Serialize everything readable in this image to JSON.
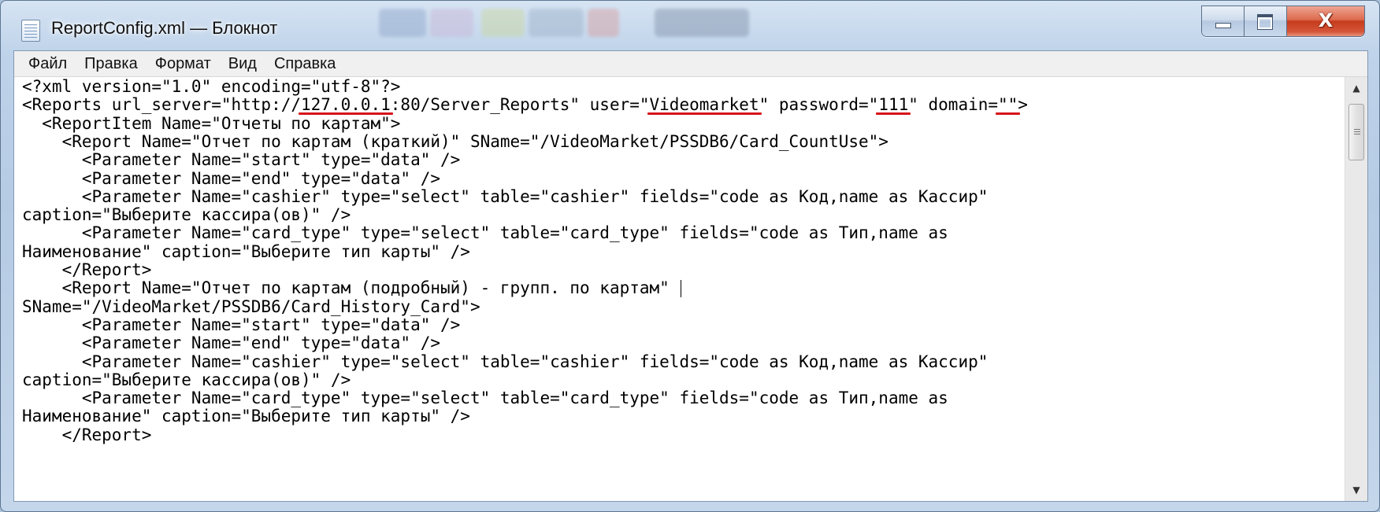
{
  "window": {
    "title": "ReportConfig.xml — Блокнот",
    "close_glyph": "X",
    "icon": "notepad-icon"
  },
  "menubar": {
    "items": [
      "Файл",
      "Правка",
      "Формат",
      "Вид",
      "Справка"
    ]
  },
  "editor": {
    "lines": [
      "<?xml version=\"1.0\" encoding=\"utf-8\"?>",
      "<Reports url_server=\"http://127.0.0.1:80/Server_Reports\" user=\"Videomarket\" password=\"111\" domain=\"\">",
      "  <ReportItem Name=\"Отчеты по картам\">",
      "    <Report Name=\"Отчет по картам (краткий)\" SName=\"/VideoMarket/PSSDB6/Card_CountUse\">",
      "      <Parameter Name=\"start\" type=\"data\" />",
      "      <Parameter Name=\"end\" type=\"data\" />",
      "      <Parameter Name=\"cashier\" type=\"select\" table=\"cashier\" fields=\"code as Код,name as Кассир\"",
      "caption=\"Выберите кассира(ов)\" />",
      "      <Parameter Name=\"card_type\" type=\"select\" table=\"card_type\" fields=\"code as Тип,name as",
      "Наименование\" caption=\"Выберите тип карты\" />",
      "    </Report>",
      "    <Report Name=\"Отчет по картам (подробный) - групп. по картам\" ",
      "SName=\"/VideoMarket/PSSDB6/Card_History_Card\">",
      "      <Parameter Name=\"start\" type=\"data\" />",
      "      <Parameter Name=\"end\" type=\"data\" />",
      "      <Parameter Name=\"cashier\" type=\"select\" table=\"cashier\" fields=\"code as Код,name as Кассир\"",
      "caption=\"Выберите кассира(ов)\" />",
      "      <Parameter Name=\"card_type\" type=\"select\" table=\"card_type\" fields=\"code as Тип,name as",
      "Наименование\" caption=\"Выберите тип карты\" />",
      "    </Report>"
    ],
    "underlines": [
      {
        "line": 1,
        "text": "127.0.0.1"
      },
      {
        "line": 1,
        "text": "Videomarket"
      },
      {
        "line": 1,
        "text": "111"
      },
      {
        "line": 1,
        "text": "\"\""
      }
    ],
    "caret_line": 11,
    "underline_color": "#d7141a"
  },
  "scrollbar": {
    "up_arrow": "▲",
    "down_arrow": "▼"
  }
}
